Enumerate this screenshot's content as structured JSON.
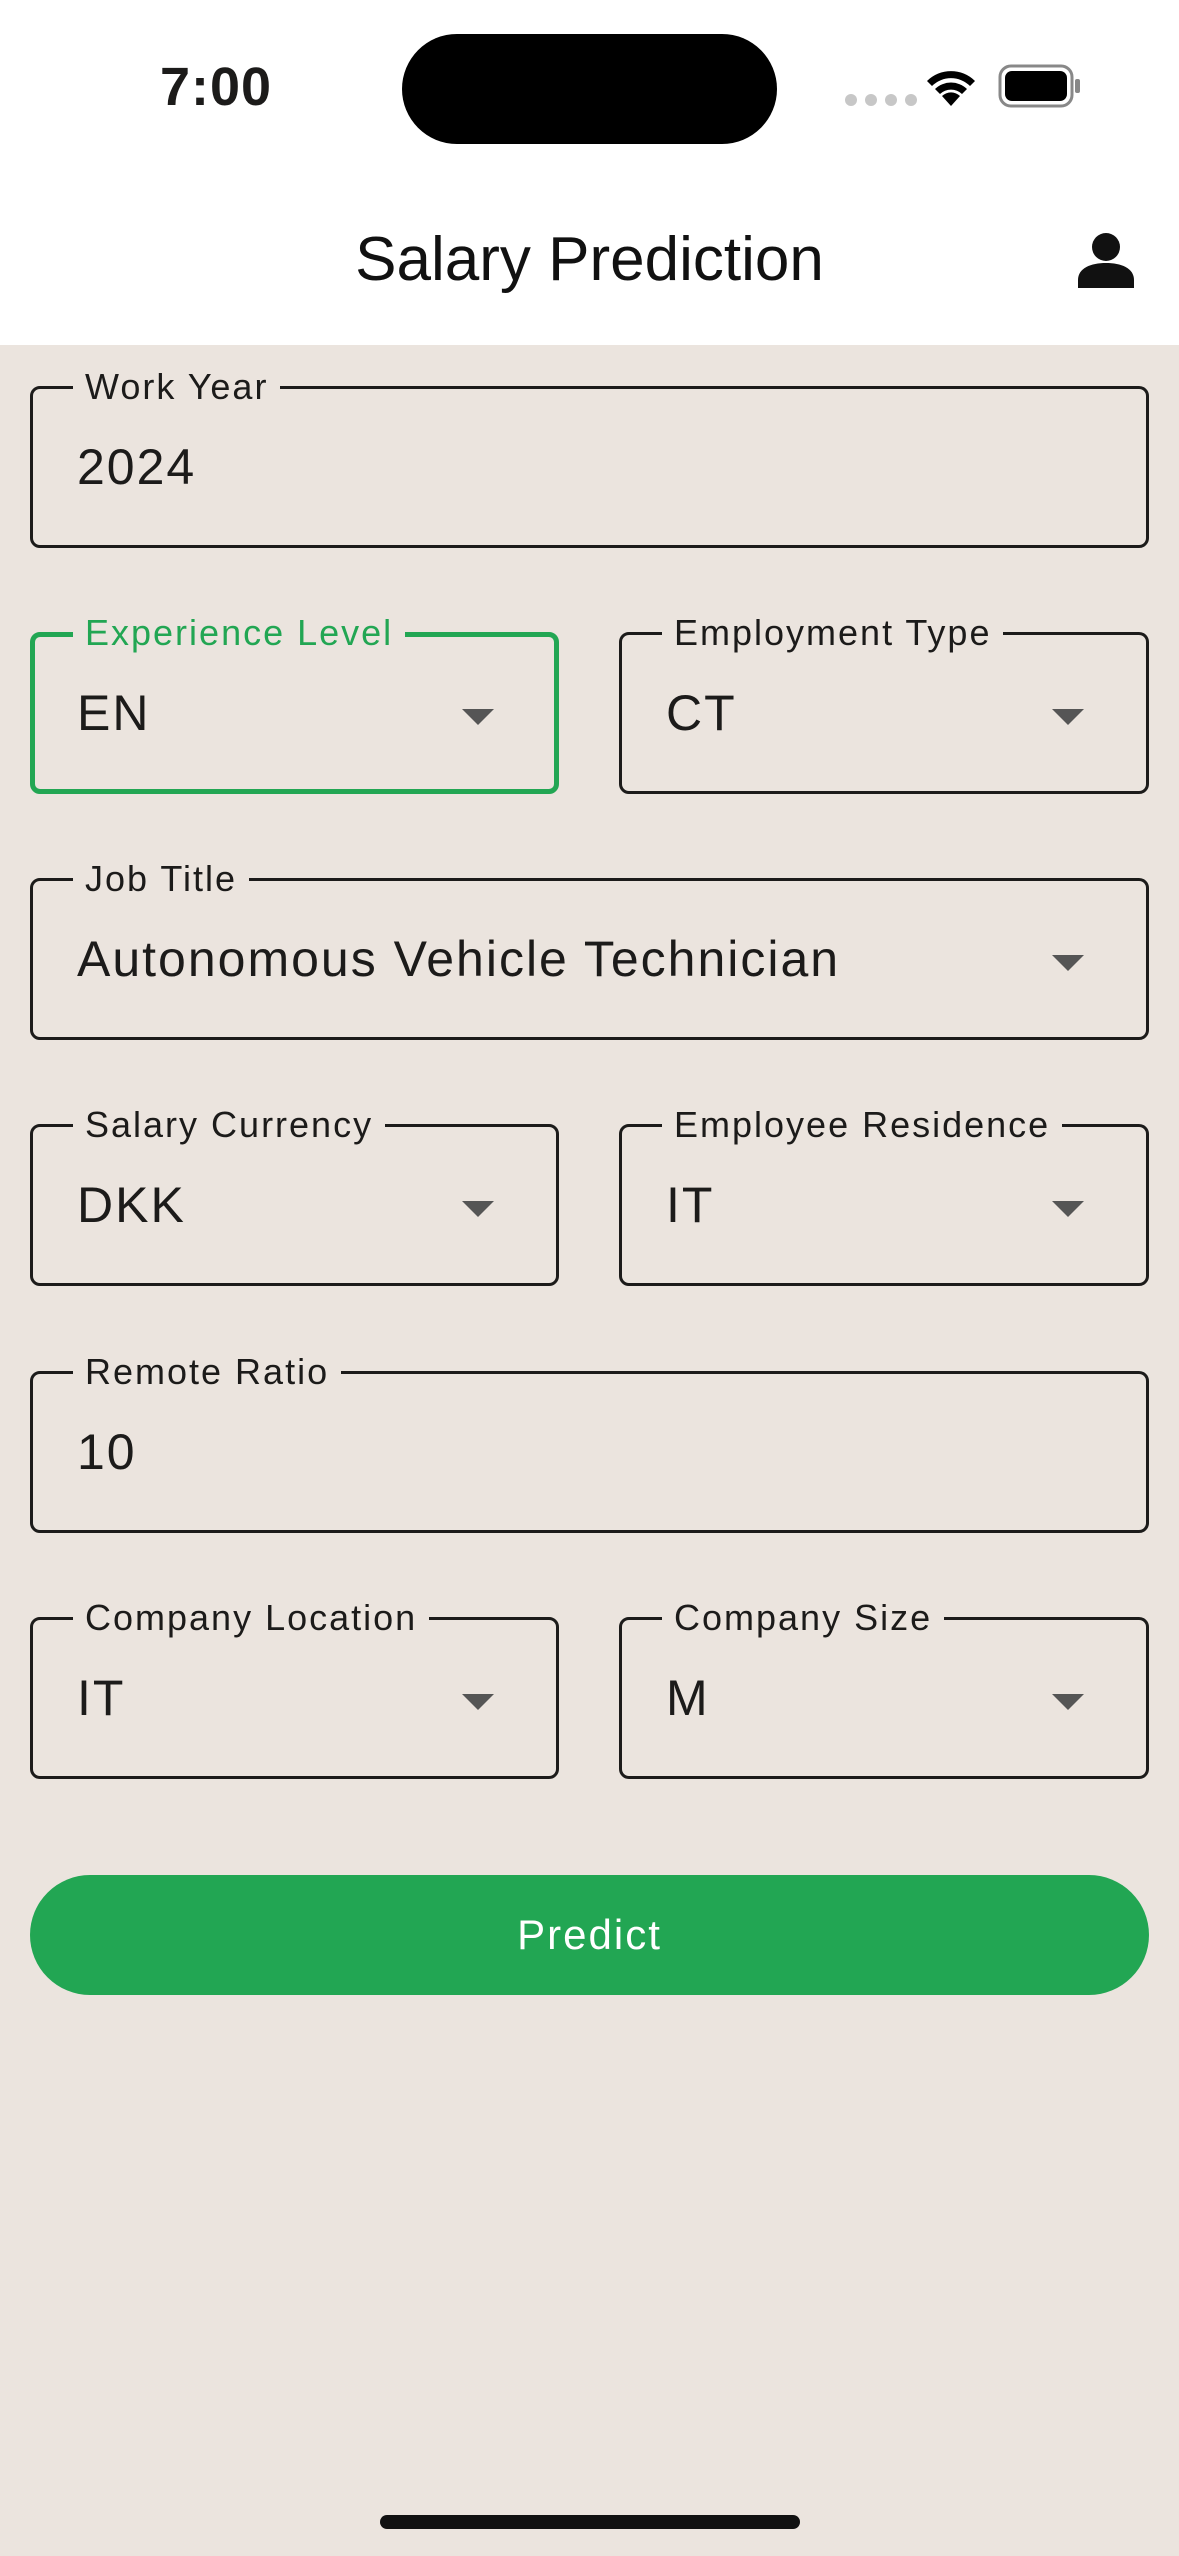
{
  "status_bar": {
    "time": "7:00"
  },
  "header": {
    "title": "Salary Prediction"
  },
  "form": {
    "work_year": {
      "label": "Work Year",
      "value": "2024"
    },
    "experience_level": {
      "label": "Experience Level",
      "value": "EN"
    },
    "employment_type": {
      "label": "Employment Type",
      "value": "CT"
    },
    "job_title": {
      "label": "Job Title",
      "value": "Autonomous Vehicle Technician"
    },
    "salary_currency": {
      "label": "Salary Currency",
      "value": "DKK"
    },
    "employee_residence": {
      "label": "Employee Residence",
      "value": "IT"
    },
    "remote_ratio": {
      "label": "Remote Ratio",
      "value": "10"
    },
    "company_location": {
      "label": "Company Location",
      "value": "IT"
    },
    "company_size": {
      "label": "Company Size",
      "value": "M"
    }
  },
  "actions": {
    "predict_label": "Predict"
  },
  "colors": {
    "accent": "#22a653",
    "background": "#ebe4de",
    "header_background": "#ffffff",
    "text": "#1c1b1a"
  },
  "icons": {
    "profile": "person-icon",
    "dropdown": "dropdown-arrow-icon",
    "wifi": "wifi-icon",
    "battery": "battery-icon",
    "signal": "cellular-signal-icon"
  }
}
